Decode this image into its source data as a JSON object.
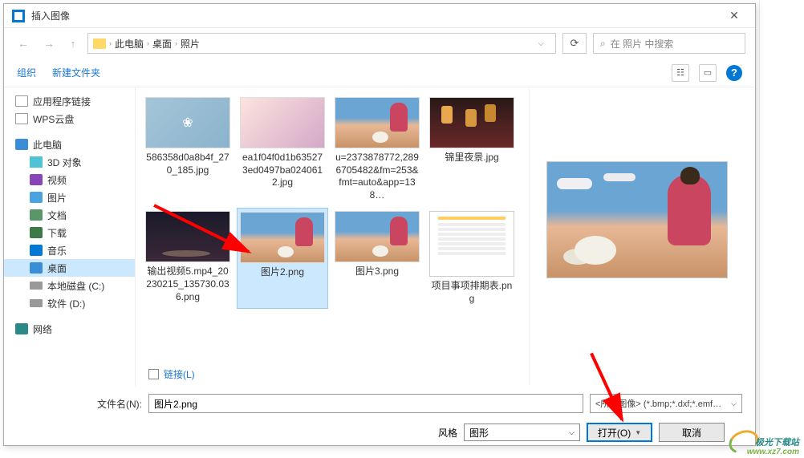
{
  "dialog": {
    "title": "插入图像"
  },
  "nav": {
    "path_root": "此电脑",
    "path_mid": "桌面",
    "path_leaf": "照片",
    "search_placeholder": "在 照片 中搜索"
  },
  "toolbar": {
    "organize": "组织",
    "new_folder": "新建文件夹"
  },
  "sidebar": {
    "app_links": "应用程序链接",
    "wps": "WPS云盘",
    "this_pc": "此电脑",
    "obj3d": "3D 对象",
    "videos": "视频",
    "pictures": "图片",
    "documents": "文档",
    "downloads": "下载",
    "music": "音乐",
    "desktop": "桌面",
    "disk_c": "本地磁盘 (C:)",
    "disk_d": "软件 (D:)",
    "network": "网络"
  },
  "files": {
    "f1": "586358d0a8b4f_270_185.jpg",
    "f2": "ea1f04f0d1b635273ed0497ba0240612.jpg",
    "f3": "u=2373878772,2896705482&fm=253&fmt=auto&app=138…",
    "f4": "锦里夜景.jpg",
    "f5": "输出视频5.mp4_20230215_135730.036.png",
    "f6": "图片2.png",
    "f7": "图片3.png",
    "f8": "项目事项排期表.png"
  },
  "link_checkbox_label": "链接(L)",
  "footer": {
    "filename_label": "文件名(N):",
    "filename_value": "图片2.png",
    "filter_label": "<所有图像> (*.bmp;*.dxf;*.emf…",
    "style_label": "风格",
    "style_value": "图形",
    "open_label": "打开(O)",
    "cancel_label": "取消"
  },
  "watermark": {
    "line1": "极光下载站",
    "line2": "www.xz7.com"
  }
}
